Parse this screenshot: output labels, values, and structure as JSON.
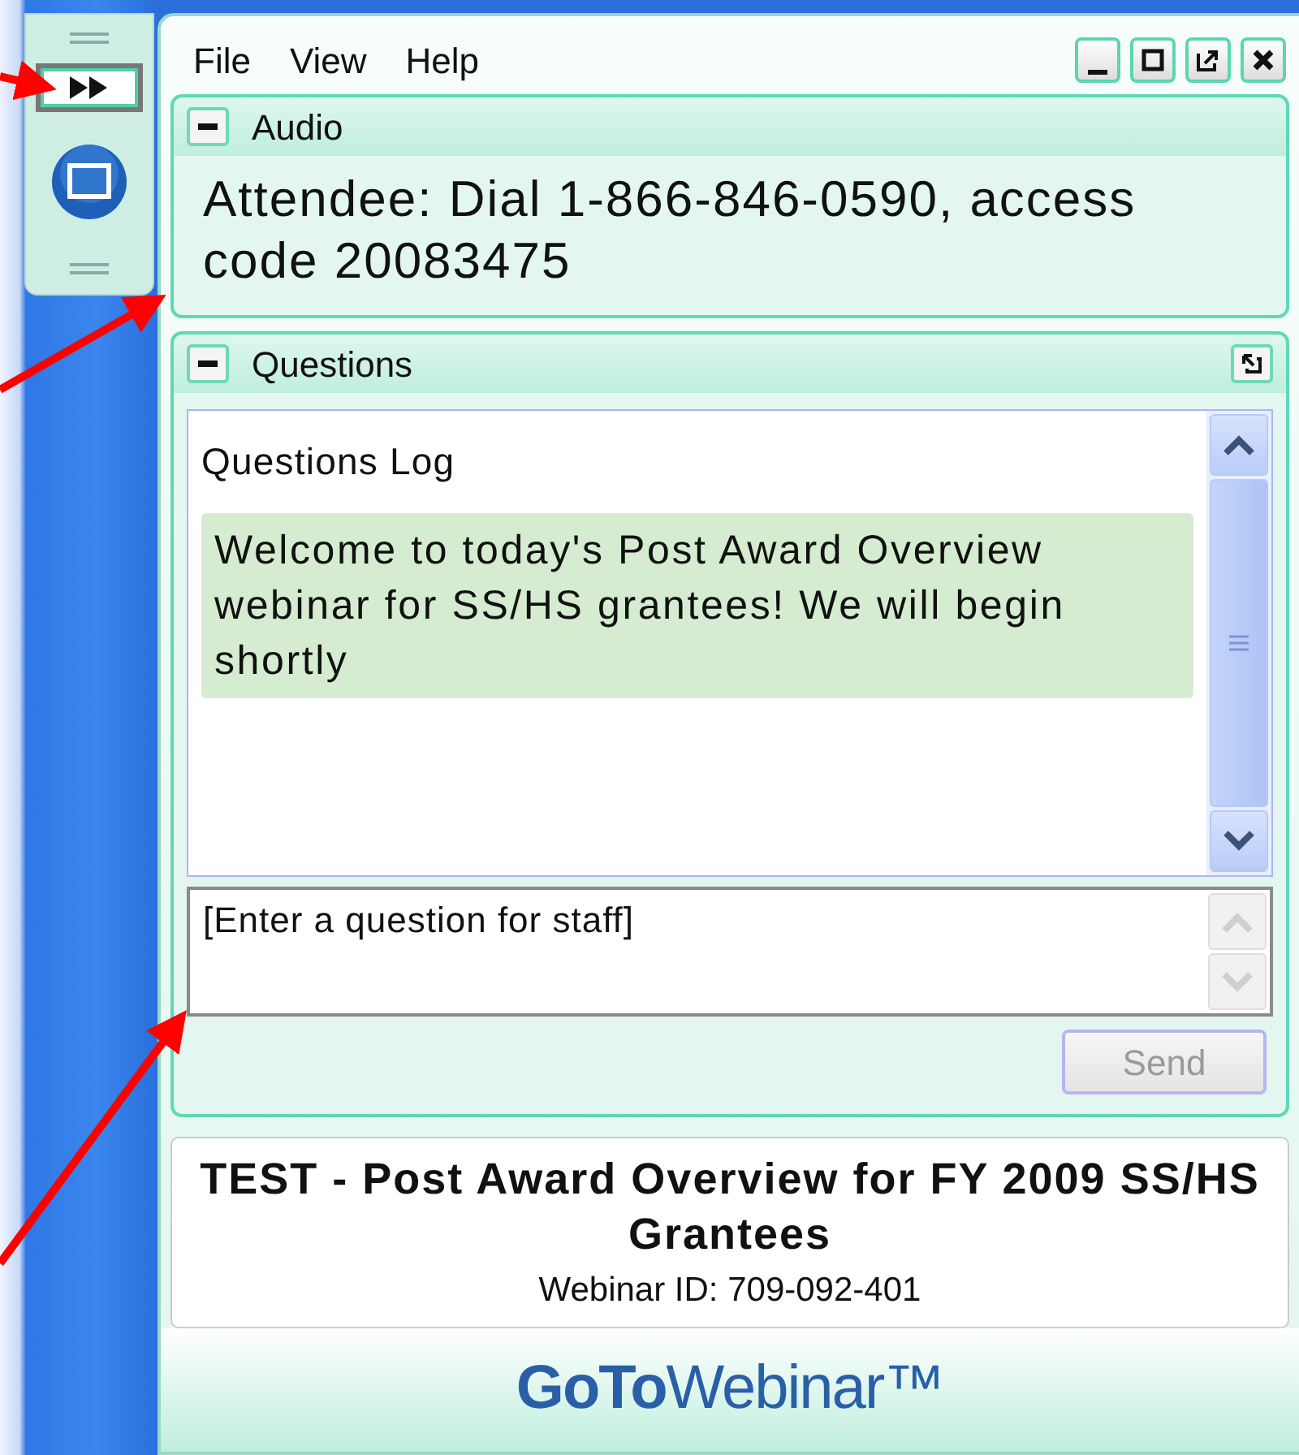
{
  "menu": [
    "File",
    "View",
    "Help"
  ],
  "window_controls": [
    {
      "kind": "minimize"
    },
    {
      "kind": "maximize"
    },
    {
      "kind": "popout"
    },
    {
      "kind": "close"
    }
  ],
  "audio": {
    "title": "Audio",
    "expanded": true,
    "text": "Attendee: Dial 1-866-846-0590, access code 20083475"
  },
  "questions": {
    "title": "Questions",
    "expanded": true,
    "log_title": "Questions Log",
    "messages": [
      "Welcome to today's Post Award Overview webinar for SS/HS grantees! We will begin shortly"
    ],
    "input": {
      "placeholder": "[Enter a question for staff]"
    },
    "send": {
      "label": "Send",
      "disabled": true
    }
  },
  "webinar": {
    "title": "TEST - Post Award Overview for FY 2009 SS/HS Grantees",
    "id": "Webinar ID: 709-092-401"
  },
  "logo": "**GoTo**Webinar™"
}
